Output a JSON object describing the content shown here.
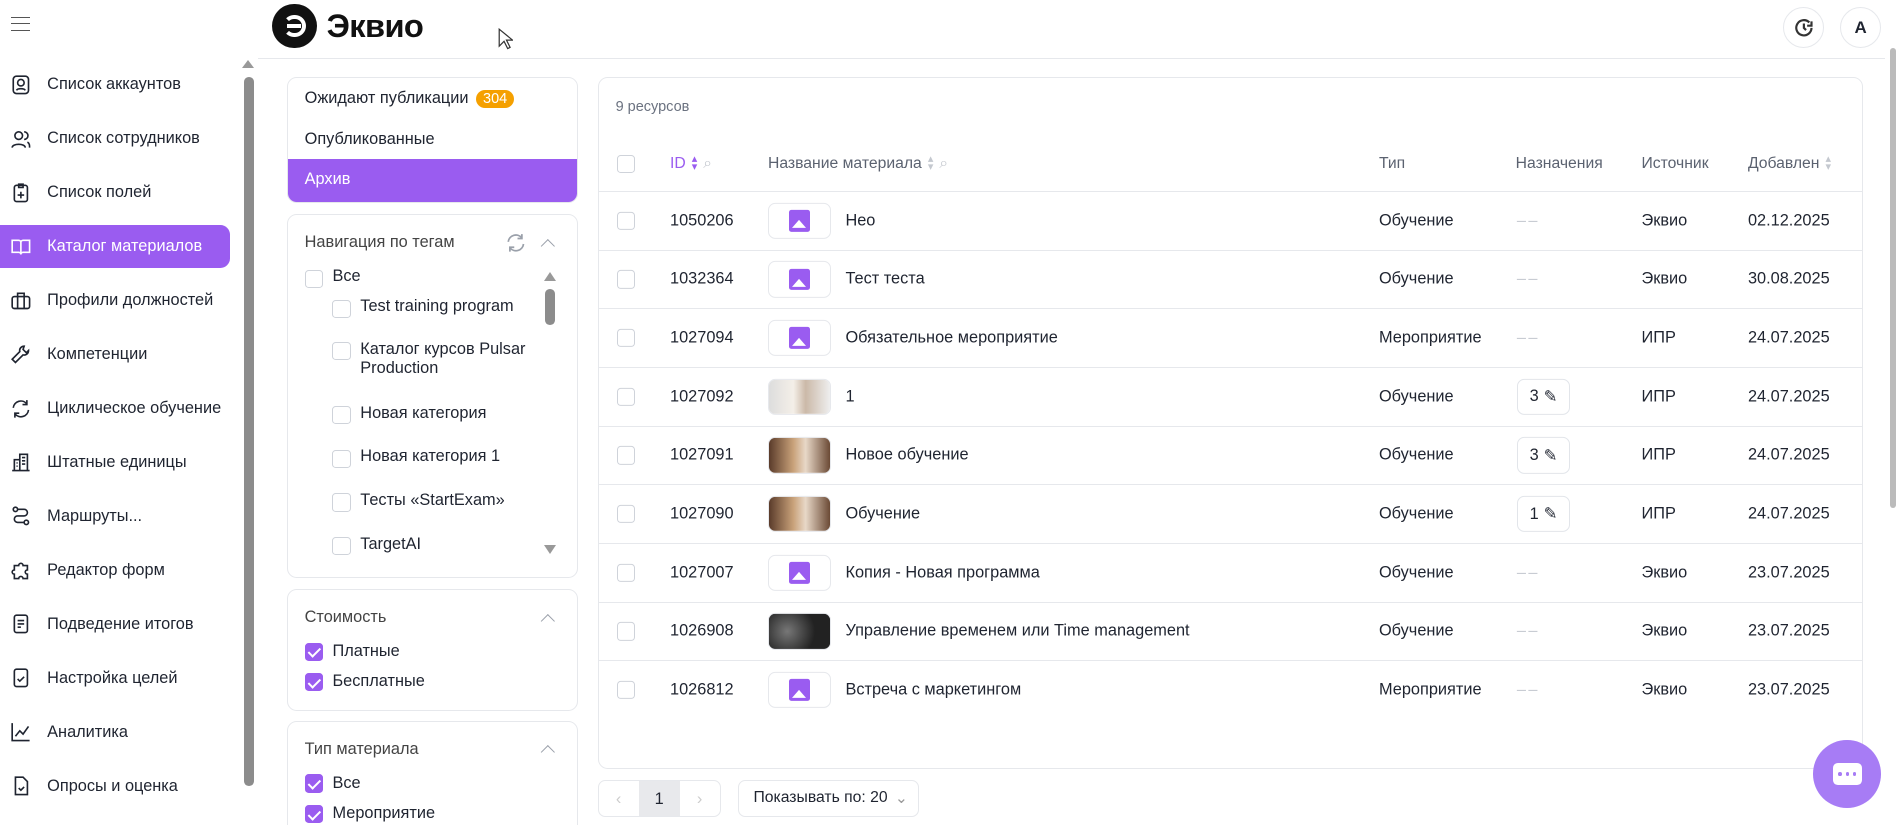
{
  "header": {
    "logo_text": "Эквио",
    "avatar_letter": "A"
  },
  "sidebar": {
    "items": [
      {
        "label": "Список аккаунтов",
        "icon": "user-card-icon"
      },
      {
        "label": "Список сотрудников",
        "icon": "users-icon"
      },
      {
        "label": "Список полей",
        "icon": "clipboard-plus-icon"
      },
      {
        "label": "Каталог материалов",
        "icon": "book-icon",
        "active": true
      },
      {
        "label": "Профили должностей",
        "icon": "briefcase-icon"
      },
      {
        "label": "Компетенции",
        "icon": "wrench-icon"
      },
      {
        "label": "Циклическое обучение",
        "icon": "refresh-icon"
      },
      {
        "label": "Штатные единицы",
        "icon": "building-icon"
      },
      {
        "label": "Маршруты...",
        "icon": "route-icon"
      },
      {
        "label": "Редактор форм",
        "icon": "puzzle-icon"
      },
      {
        "label": "Подведение итогов",
        "icon": "document-list-icon"
      },
      {
        "label": "Настройка целей",
        "icon": "document-check-icon"
      },
      {
        "label": "Аналитика",
        "icon": "chart-line-icon"
      },
      {
        "label": "Опросы и оценка",
        "icon": "survey-icon"
      }
    ]
  },
  "status_tabs": [
    {
      "label": "Ожидают публикации",
      "badge": "304"
    },
    {
      "label": "Опубликованные"
    },
    {
      "label": "Архив",
      "active": true
    }
  ],
  "tags": {
    "title": "Навигация по тегам",
    "items": [
      "Все",
      "Test training program",
      "Каталог курсов Pulsar Production",
      "Новая категория",
      "Новая категория 1",
      "Тесты «StartExam»",
      "TargetAI"
    ]
  },
  "cost": {
    "title": "Стоимость",
    "items": [
      {
        "label": "Платные",
        "checked": true
      },
      {
        "label": "Бесплатные",
        "checked": true
      }
    ]
  },
  "material_type": {
    "title": "Тип материала",
    "items": [
      {
        "label": "Все",
        "checked": true
      },
      {
        "label": "Мероприятие",
        "checked": true
      }
    ]
  },
  "table": {
    "count": "9 ресурсов",
    "columns": {
      "id": "ID",
      "name": "Название материала",
      "type": "Тип",
      "assign": "Назначения",
      "source": "Источник",
      "added": "Добавлен"
    },
    "rows": [
      {
        "id": "1050206",
        "name": "Нео",
        "type": "Обучение",
        "assign": "",
        "source": "Эквио",
        "date": "02.12.2025",
        "thumb": "placeholder"
      },
      {
        "id": "1032364",
        "name": "Тест теста",
        "type": "Обучение",
        "assign": "",
        "source": "Эквио",
        "date": "30.08.2025",
        "thumb": "placeholder"
      },
      {
        "id": "1027094",
        "name": "Обязательное мероприятие",
        "type": "Мероприятие",
        "assign": "",
        "source": "ИПР",
        "date": "24.07.2025",
        "thumb": "placeholder"
      },
      {
        "id": "1027092",
        "name": "1",
        "type": "Обучение",
        "assign": "3",
        "source": "ИПР",
        "date": "24.07.2025",
        "thumb": "photo-light"
      },
      {
        "id": "1027091",
        "name": "Новое обучение",
        "type": "Обучение",
        "assign": "3",
        "source": "ИПР",
        "date": "24.07.2025",
        "thumb": "photo"
      },
      {
        "id": "1027090",
        "name": "Обучение",
        "type": "Обучение",
        "assign": "1",
        "source": "ИПР",
        "date": "24.07.2025",
        "thumb": "photo"
      },
      {
        "id": "1027007",
        "name": "Копия - Новая программа",
        "type": "Обучение",
        "assign": "",
        "source": "Эквио",
        "date": "23.07.2025",
        "thumb": "placeholder"
      },
      {
        "id": "1026908",
        "name": "Управление временем или Time management",
        "type": "Обучение",
        "assign": "",
        "source": "Эквио",
        "date": "23.07.2025",
        "thumb": "photo-dark"
      },
      {
        "id": "1026812",
        "name": "Встреча с маркетингом",
        "type": "Мероприятие",
        "assign": "",
        "source": "Эквио",
        "date": "23.07.2025",
        "thumb": "placeholder"
      }
    ]
  },
  "pagination": {
    "current": "1",
    "page_size_label": "Показывать по: 20"
  },
  "colors": {
    "accent": "#9a5cf0",
    "badge": "#f5a000"
  }
}
